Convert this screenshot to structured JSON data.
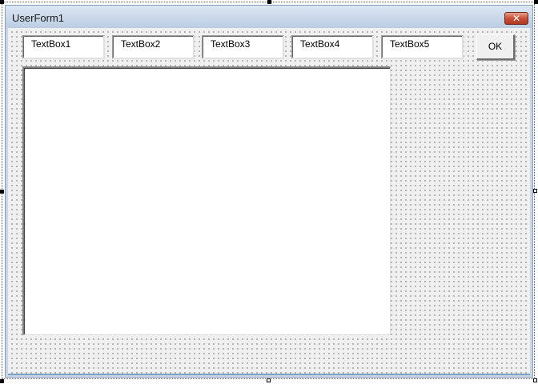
{
  "form": {
    "title": "UserForm1",
    "close_glyph": "✕"
  },
  "textboxes": [
    {
      "label": "TextBox1"
    },
    {
      "label": "TextBox2"
    },
    {
      "label": "TextBox3"
    },
    {
      "label": "TextBox4"
    },
    {
      "label": "TextBox5"
    }
  ],
  "buttons": {
    "ok_label": "OK"
  },
  "colors": {
    "client_background": "#f0f0f0",
    "titlebar": "#c9d6e6",
    "close_button": "#c94e35"
  },
  "icons": {
    "close": "close-icon"
  }
}
